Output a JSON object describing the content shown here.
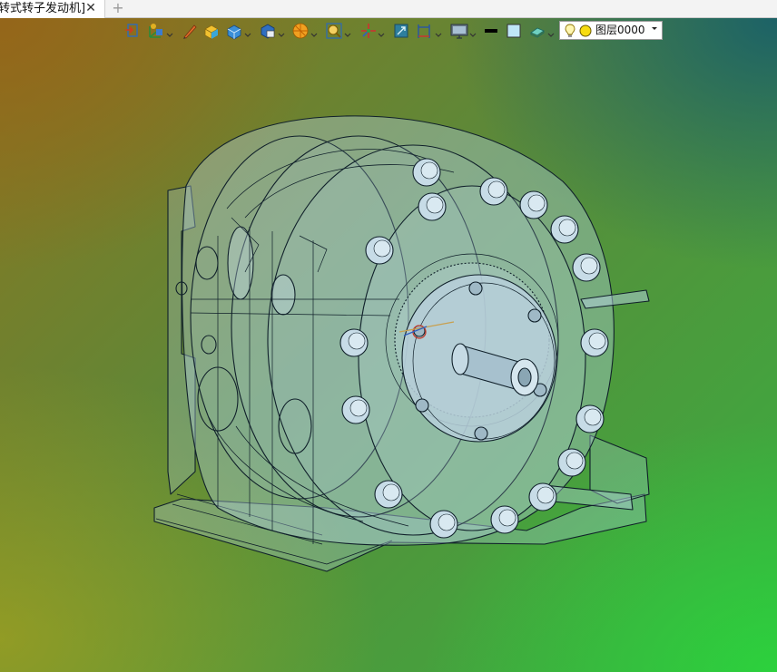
{
  "tabs": [
    {
      "label": "转式转子发动机]",
      "active": true
    }
  ],
  "new_tab_label": "+",
  "close_label": "✕",
  "toolbar": {
    "buttons": [
      {
        "name": "import-icon",
        "has_dropdown": false
      },
      {
        "name": "view-orientation-icon",
        "has_dropdown": true
      },
      {
        "name": "pen-icon",
        "has_dropdown": false
      },
      {
        "name": "shaded-box-icon",
        "has_dropdown": false
      },
      {
        "name": "view-box-icon",
        "has_dropdown": true
      },
      {
        "name": "display-style-icon",
        "has_dropdown": true
      },
      {
        "name": "render-mode-icon",
        "has_dropdown": true
      },
      {
        "name": "zoom-icon",
        "has_dropdown": true
      },
      {
        "name": "triad-icon",
        "has_dropdown": true
      },
      {
        "name": "fit-icon",
        "has_dropdown": false
      },
      {
        "name": "measure-icon",
        "has_dropdown": true
      },
      {
        "name": "monitor-icon",
        "has_dropdown": true
      },
      {
        "name": "line-color-icon",
        "has_dropdown": false
      },
      {
        "name": "fill-color-icon",
        "has_dropdown": false
      },
      {
        "name": "material-icon",
        "has_dropdown": true
      }
    ],
    "layer": {
      "name": "图层0000",
      "light_icon": "light-bulb-icon",
      "status_icon": "layer-status-icon"
    }
  },
  "colors": {
    "background_top_left": "#97702a",
    "background_top_right": "#1f6e6a",
    "background_bottom_left": "#b4ab14",
    "background_bottom_right": "#28d23c",
    "model_glass": "#b6d2e4",
    "model_edge": "#10202a"
  }
}
